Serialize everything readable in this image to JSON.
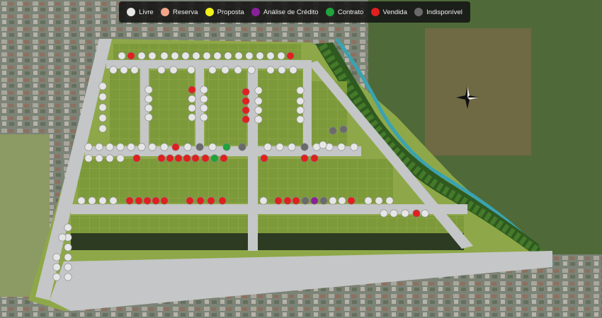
{
  "legend": {
    "items": [
      {
        "label": "Livre",
        "color": "#e6e6e6",
        "icon": "status-dot"
      },
      {
        "label": "Reserva",
        "color": "#f3a38a",
        "icon": "status-dot"
      },
      {
        "label": "Proposta",
        "color": "#f2ef1a",
        "icon": "status-dot"
      },
      {
        "label": "Análise de Crédito",
        "color": "#8a1f9a",
        "icon": "status-dot"
      },
      {
        "label": "Contrato",
        "color": "#1fa33a",
        "icon": "status-dot"
      },
      {
        "label": "Vendida",
        "color": "#e01f1f",
        "icon": "status-dot"
      },
      {
        "label": "Indisponível",
        "color": "#6a6a6a",
        "icon": "status-dot"
      }
    ]
  },
  "map": {
    "compass_icon": "compass-rose-icon",
    "status_counts": {
      "Livre": 171,
      "Vendida": 36,
      "Contrato": 1,
      "Análise de Crédito": 1,
      "Indisponível": 4
    }
  }
}
